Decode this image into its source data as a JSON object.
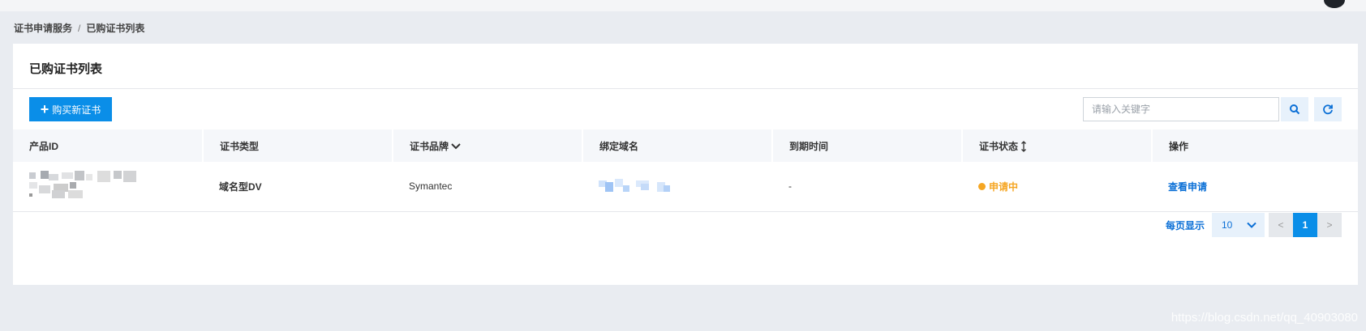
{
  "breadcrumb": {
    "parent": "证书申请服务",
    "separator": "/",
    "current": "已购证书列表"
  },
  "panel": {
    "title": "已购证书列表"
  },
  "toolbar": {
    "buy_label": "购买新证书",
    "buy_icon": "plus-icon",
    "search_placeholder": "请输入关键字",
    "search_icon": "search-icon",
    "refresh_icon": "refresh-icon"
  },
  "table": {
    "headers": [
      "产品ID",
      "证书类型",
      "证书品牌",
      "绑定域名",
      "到期时间",
      "证书状态",
      "操作"
    ],
    "rows": [
      {
        "product_id": "",
        "type": "域名型DV",
        "brand": "Symantec",
        "domain": "",
        "expiry": "-",
        "status": "申请中",
        "action": "查看申请"
      }
    ]
  },
  "pagination": {
    "per_page_label": "每页显示",
    "per_page_value": "10",
    "prev": "<",
    "current_page": "1",
    "next": ">"
  },
  "watermark": "https://blog.csdn.net/qq_40903080",
  "colors": {
    "primary": "#0a8ee8",
    "status_pending": "#f5a623",
    "link": "#0a6fd6"
  }
}
